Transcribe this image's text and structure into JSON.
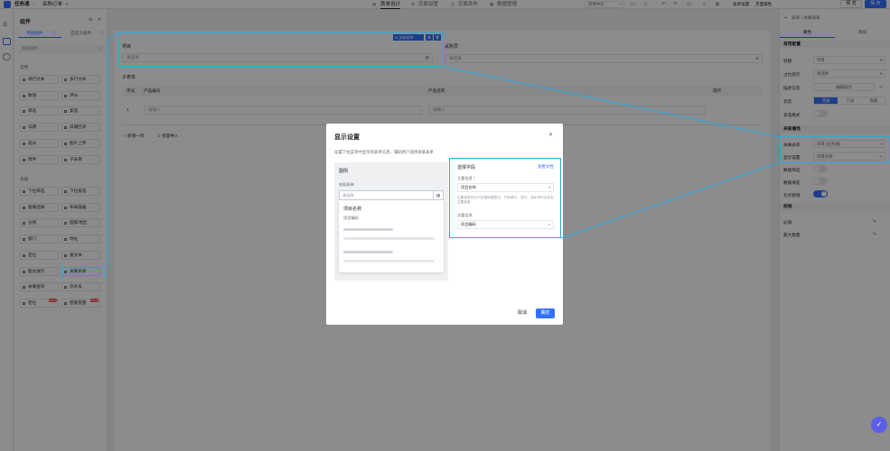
{
  "topbar": {
    "breadcrumb_root": "任务通",
    "breadcrumb_current": "采购订单",
    "tabs": [
      "表单设计",
      "页面设置",
      "页面发布",
      "数据管理"
    ],
    "active_tab": "表单设计",
    "lang": "简体中文",
    "form_settings": "表单设置",
    "page_props": "页面属性",
    "preview": "预 览",
    "save": "保 存"
  },
  "components": {
    "title": "组件",
    "tab_add": "添加组件",
    "tab_custom": "自定义组件",
    "search_placeholder": "搜索组件",
    "group_common": "常用",
    "group_advanced": "高级",
    "common": [
      {
        "label": "单行文本"
      },
      {
        "label": "多行文本"
      },
      {
        "label": "数值"
      },
      {
        "label": "评分"
      },
      {
        "label": "单选"
      },
      {
        "label": "复选"
      },
      {
        "label": "日期"
      },
      {
        "label": "日期区间"
      },
      {
        "label": "成员"
      },
      {
        "label": "图片上传"
      },
      {
        "label": "附件"
      },
      {
        "label": "子表单"
      }
    ],
    "advanced": [
      {
        "label": "下拉单选"
      },
      {
        "label": "下拉复选"
      },
      {
        "label": "级联选择"
      },
      {
        "label": "布局容器"
      },
      {
        "label": "分组"
      },
      {
        "label": "国家/地区"
      },
      {
        "label": "部门"
      },
      {
        "label": "地址"
      },
      {
        "label": "定位"
      },
      {
        "label": "富文本"
      },
      {
        "label": "图文展示"
      },
      {
        "label": "关联表单"
      },
      {
        "label": "关联查询"
      },
      {
        "label": "流水号"
      },
      {
        "label": "定位",
        "badge": "NEW"
      },
      {
        "label": "智能变量",
        "badge": "NEW"
      }
    ]
  },
  "canvas": {
    "field1_label": "项目",
    "field1_placeholder": "请选择",
    "field1_tag": "关联表单",
    "field2_label": "采购员",
    "field2_placeholder": "请选择",
    "subform_title": "子表单",
    "columns": [
      "序号",
      "产品编号",
      "产品名称",
      "操作"
    ],
    "row_index": "1",
    "row_input": "请输入",
    "add_row": "新增一项",
    "batch_import": "批量导入"
  },
  "modal": {
    "title": "显示设置",
    "desc": "设置下拉菜单中显示的表单信息，辅助用户选择关联表单",
    "example_label": "图例",
    "assoc_label": "关联表单",
    "assoc_placeholder": "请选择",
    "card_title": "项目名称",
    "card_sub": "项目编码",
    "field_title": "选择字段",
    "doc_link": "查看文档",
    "main_label": "主要信息 *",
    "main_value": "项目名称",
    "main_hint": "主要信息作为下拉框标题显示，只有单行、多行、流水号可以作为主要信息",
    "sub_label": "次要信息",
    "sub_value": "项目编码",
    "cancel": "取消",
    "ok": "确定"
  },
  "props": {
    "breadcrumb": "表单  ›  关联表单",
    "tab_props": "属性",
    "tab_advanced": "高级",
    "sec_common": "常用配置",
    "title_label": "标题",
    "title_value": "项目",
    "placeholder_label": "占位提示",
    "placeholder_value": "请选择",
    "desc_label": "描述信息",
    "desc_button": "编辑描述",
    "state_label": "状态",
    "state_options": [
      "普通",
      "只读",
      "隐藏"
    ],
    "multi_label": "多选模式",
    "sec_assoc": "关联属性",
    "assoc_form_label": "关联表单",
    "assoc_form_value": "项目 (任务通)",
    "display_label": "显示设置",
    "display_value": "项目名称",
    "filter_label": "数据筛选",
    "fill_label": "数据填充",
    "allow_new_label": "允许新增",
    "sec_validate": "校验",
    "required_label": "必填",
    "max_label": "最大数量"
  },
  "colors": {
    "primary": "#3370ff",
    "highlight": "#29abe2",
    "new_badge": "#f54a45"
  }
}
